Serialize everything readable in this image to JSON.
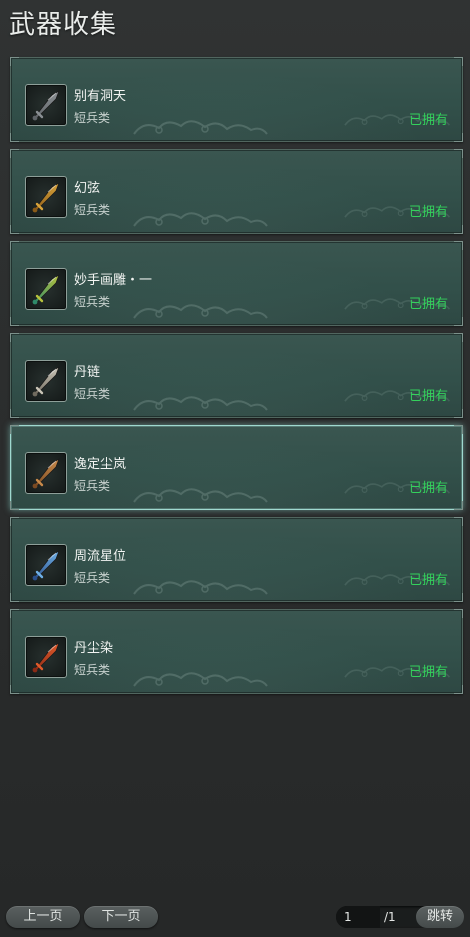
{
  "page": {
    "title": "武器收集"
  },
  "weapons": [
    {
      "name": "别有洞天",
      "type": "短兵类",
      "status": "已拥有",
      "icon": "broad-blade-icon",
      "colors": [
        "#8a8f93",
        "#5f6468"
      ]
    },
    {
      "name": "幻弦",
      "type": "短兵类",
      "status": "已拥有",
      "icon": "golden-claw-icon",
      "colors": [
        "#d8a33a",
        "#8a5a18"
      ]
    },
    {
      "name": "妙手画雕・一",
      "type": "短兵类",
      "status": "已拥有",
      "icon": "jade-hook-icon",
      "colors": [
        "#b7c23c",
        "#2f8a6a"
      ]
    },
    {
      "name": "丹链",
      "type": "短兵类",
      "status": "已拥有",
      "icon": "silver-mace-icon",
      "colors": [
        "#c9c4b6",
        "#6f6a5e"
      ]
    },
    {
      "name": "逸定尘岚",
      "type": "短兵类",
      "status": "已拥有",
      "icon": "bronze-dagger-icon",
      "colors": [
        "#c88a4a",
        "#7a4a22"
      ]
    },
    {
      "name": "周流星位",
      "type": "短兵类",
      "status": "已拥有",
      "icon": "star-blade-icon",
      "colors": [
        "#6fb0e6",
        "#2a4f8a"
      ]
    },
    {
      "name": "丹尘染",
      "type": "短兵类",
      "status": "已拥有",
      "icon": "flame-blade-icon",
      "colors": [
        "#e05a2a",
        "#8a2a16"
      ]
    }
  ],
  "selected_index": 4,
  "pager": {
    "prev_label": "上一页",
    "next_label": "下一页",
    "current_page": "1",
    "total": "/1",
    "jump_label": "跳转"
  },
  "colors": {
    "owned": "#34d15c",
    "card": "#32504a",
    "selected_border": "#9fd9cf"
  }
}
